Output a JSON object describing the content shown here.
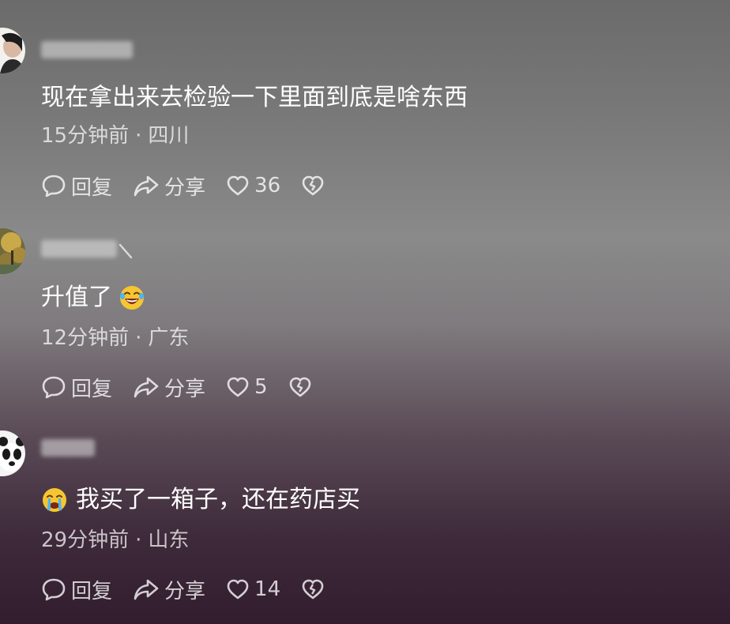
{
  "colors": {
    "text": "#ffffff",
    "meta_text": "rgba(255,255,255,0.72)",
    "background_top": "#6b6b6b",
    "background_bottom": "#321d2e"
  },
  "comments": [
    {
      "text": "现在拿出来去检验一下里面到底是啥东西",
      "time": "15分钟前",
      "separator": "·",
      "location": "四川",
      "reply_label": "回复",
      "share_label": "分享",
      "like_count": "36",
      "icons": [
        "reply-icon",
        "share-icon",
        "heart-icon",
        "broken-heart-icon"
      ]
    },
    {
      "text": "升值了",
      "emoji": "laughing-crying-emoji",
      "time": "12分钟前",
      "separator": "·",
      "location": "广东",
      "reply_label": "回复",
      "share_label": "分享",
      "like_count": "5",
      "icons": [
        "reply-icon",
        "share-icon",
        "heart-icon",
        "broken-heart-icon"
      ]
    },
    {
      "text": "我买了一箱子，还在药店买",
      "emoji": "crying-emoji",
      "time": "29分钟前",
      "separator": "·",
      "location": "山东",
      "reply_label": "回复",
      "share_label": "分享",
      "like_count": "14",
      "icons": [
        "reply-icon",
        "share-icon",
        "heart-icon",
        "broken-heart-icon"
      ]
    }
  ]
}
